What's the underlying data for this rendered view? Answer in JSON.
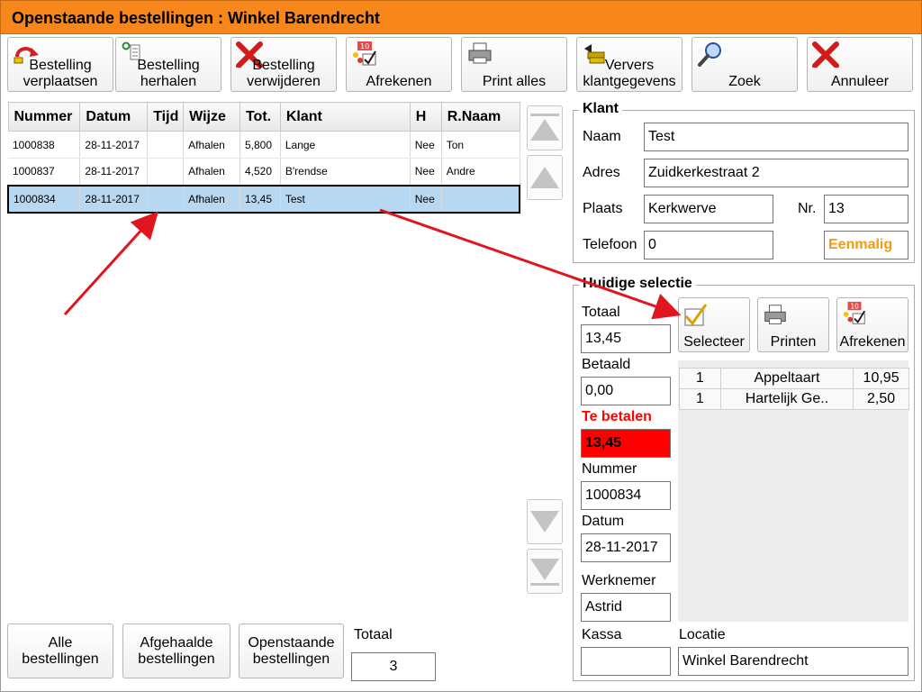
{
  "window": {
    "title": "Openstaande bestellingen : Winkel Barendrecht"
  },
  "toolbar": [
    {
      "label": "Bestelling\nverplaatsen",
      "icon": "move-order-icon"
    },
    {
      "label": "Bestelling\nherhalen",
      "icon": "repeat-order-icon"
    },
    {
      "label": "Bestelling\nverwijderen",
      "icon": "delete-x-icon"
    },
    {
      "label": "Afrekenen",
      "icon": "checkout-icon"
    },
    {
      "label": "Print alles",
      "icon": "printer-icon"
    },
    {
      "label": "Ververs\nklantgegevens",
      "icon": "refresh-customer-icon"
    },
    {
      "label": "Zoek",
      "icon": "search-icon"
    },
    {
      "label": "Annuleer",
      "icon": "cancel-x-icon"
    }
  ],
  "orders": {
    "columns": [
      "Nummer",
      "Datum",
      "Tijd",
      "Wijze",
      "Tot.",
      "Klant",
      "H",
      "R.Naam"
    ],
    "rows": [
      [
        "1000838",
        "28-11-2017",
        "",
        "Afhalen",
        "5,800",
        "Lange",
        "Nee",
        "Ton"
      ],
      [
        "1000837",
        "28-11-2017",
        "",
        "Afhalen",
        "4,520",
        "B'rendse",
        "Nee",
        "Andre"
      ],
      [
        "1000834",
        "28-11-2017",
        "",
        "Afhalen",
        "13,45",
        "Test",
        "Nee",
        ""
      ]
    ],
    "selected_index": 2
  },
  "klant": {
    "legend": "Klant",
    "naam_label": "Naam",
    "naam": "Test",
    "adres_label": "Adres",
    "adres": "Zuidkerkestraat 2",
    "plaats_label": "Plaats",
    "plaats": "Kerkwerve",
    "nr_label": "Nr.",
    "nr": "13",
    "telefoon_label": "Telefoon",
    "telefoon": "0",
    "eenmalig": "Eenmalig",
    "eenmalig_color": "#f29a0e"
  },
  "selectie": {
    "legend": "Huidige selectie",
    "totaal_label": "Totaal",
    "totaal": "13,45",
    "betaald_label": "Betaald",
    "betaald": "0,00",
    "te_betalen_label": "Te betalen",
    "te_betalen": "13,45",
    "te_betalen_color": "#ff0000",
    "nummer_label": "Nummer",
    "nummer": "1000834",
    "datum_label": "Datum",
    "datum": "28-11-2017",
    "werknemer_label": "Werknemer",
    "werknemer": "Astrid",
    "kassa_label": "Kassa",
    "kassa": "",
    "locatie_label": "Locatie",
    "locatie": "Winkel Barendrecht",
    "buttons": [
      {
        "label": "Selecteer",
        "icon": "checkmark-icon"
      },
      {
        "label": "Printen",
        "icon": "printer-icon"
      },
      {
        "label": "Afrekenen",
        "icon": "checkout-icon"
      }
    ],
    "items": [
      [
        "1",
        "Appeltaart",
        "10,95"
      ],
      [
        "1",
        "Hartelijk Ge..",
        "2,50"
      ]
    ]
  },
  "bottom": {
    "alle": "Alle\nbestellingen",
    "afgehaalde": "Afgehaalde\nbestellingen",
    "openstaande": "Openstaande\nbestellingen",
    "totaal_label": "Totaal",
    "totaal": "3"
  },
  "accent_color": "#f7861b"
}
